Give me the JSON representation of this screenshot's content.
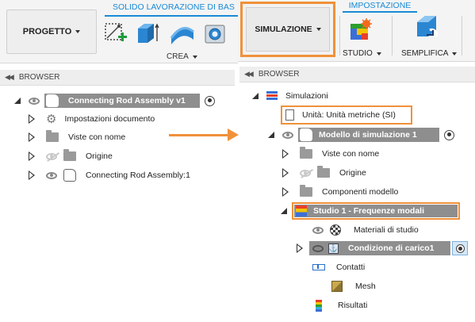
{
  "left": {
    "project_button": "PROGETTO",
    "tab_label": "SOLIDO LAVORAZIONE DI BAS",
    "create_label": "CREA",
    "browser_label": "BROWSER",
    "root_label": "Connecting Rod Assembly v1",
    "items": [
      {
        "label": "Impostazioni documento",
        "icon": "gear-icon"
      },
      {
        "label": "Viste con nome",
        "icon": "folder-icon"
      },
      {
        "label": "Origine",
        "icon": "folder-icon"
      },
      {
        "label": "Connecting Rod Assembly:1",
        "icon": "component-icon"
      }
    ]
  },
  "right": {
    "simulation_button": "SIMULAZIONE",
    "tab_label": "IMPOSTAZIONE",
    "study_label": "STUDIO",
    "simplify_label": "SEMPLIFICA",
    "browser_label": "BROWSER",
    "simulations_label": "Simulazioni",
    "units_label": "Unità: Unità metriche (SI)",
    "model_label": "Modello di simulazione 1",
    "model_items": [
      {
        "label": "Viste con nome"
      },
      {
        "label": "Origine"
      },
      {
        "label": "Componenti modello"
      }
    ],
    "study_label_tree": "Studio 1 - Frequenze modali",
    "study_items": [
      {
        "label": "Materiali di studio",
        "icon": "materials-icon"
      },
      {
        "label": "Condizione di carico1",
        "icon": "load-case-icon"
      },
      {
        "label": "Contatti",
        "icon": "contacts-icon"
      },
      {
        "label": "Mesh",
        "icon": "mesh-icon"
      },
      {
        "label": "Risultati",
        "icon": "results-icon"
      }
    ]
  },
  "colors": {
    "accent_orange": "#f0913a",
    "tab_blue": "#1a8ad6",
    "highlight_gray": "#8e8e8e",
    "selected_blue": "#d6e8f7"
  }
}
